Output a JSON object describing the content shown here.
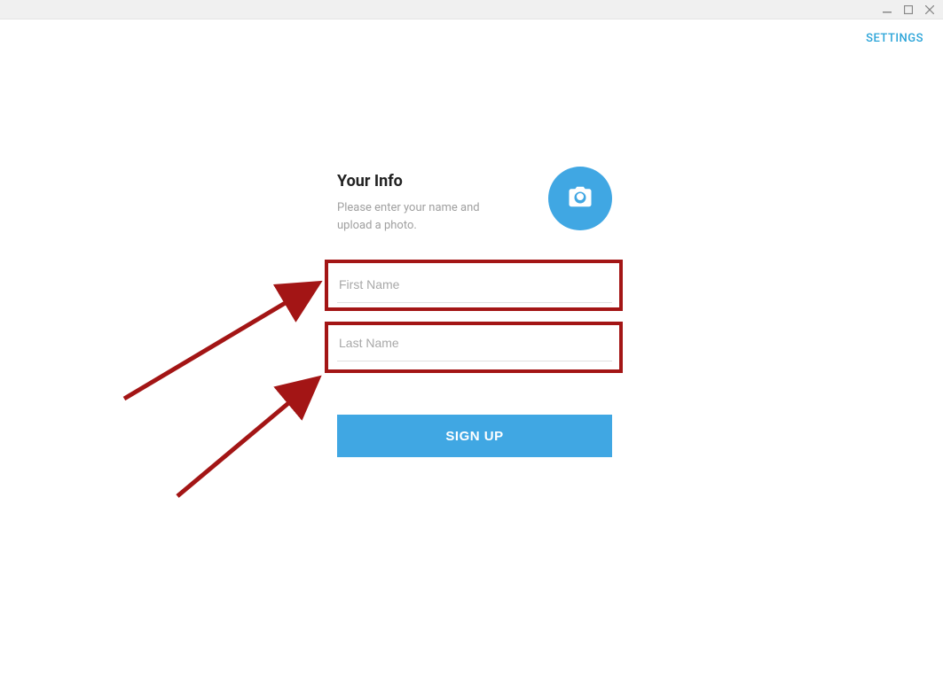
{
  "window": {
    "minimize": "—",
    "maximize": "◻",
    "close": "✕"
  },
  "header": {
    "settings_label": "SETTINGS"
  },
  "form": {
    "title": "Your Info",
    "subtitle": "Please enter your name and upload a photo.",
    "first_name_placeholder": "First Name",
    "first_name_value": "",
    "last_name_placeholder": "Last Name",
    "last_name_value": "",
    "signup_label": "SIGN UP"
  }
}
